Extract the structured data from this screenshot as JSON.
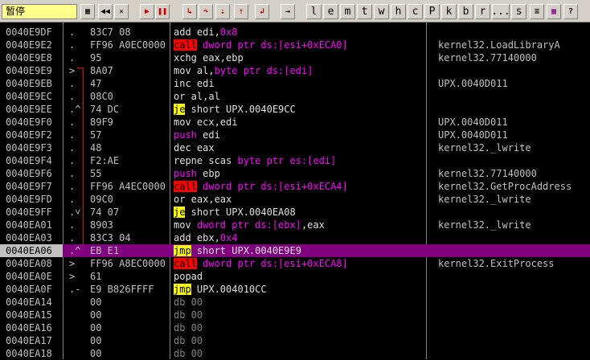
{
  "toolbar": {
    "status_text": "暂停",
    "buttons": [
      {
        "name": "open-file-icon",
        "glyph": "▦"
      },
      {
        "name": "rewind-icon",
        "glyph": "◀◀"
      },
      {
        "name": "close-icon",
        "glyph": "✕"
      },
      {
        "name": "run-icon",
        "glyph": "▶"
      },
      {
        "name": "pause-icon",
        "glyph": "❚❚"
      },
      {
        "name": "step-into-icon",
        "glyph": "↳"
      },
      {
        "name": "step-over-icon",
        "glyph": "↷"
      },
      {
        "name": "animate-into-icon",
        "glyph": "⇣"
      },
      {
        "name": "animate-over-icon",
        "glyph": "⇡"
      },
      {
        "name": "execute-till-return-icon",
        "glyph": "↲"
      },
      {
        "name": "goto-icon",
        "glyph": "→"
      }
    ],
    "letters": [
      "l",
      "e",
      "m",
      "t",
      "w",
      "h",
      "c",
      "P",
      "k",
      "b",
      "r",
      "...",
      "s"
    ],
    "right_icons": [
      {
        "name": "list-icon",
        "glyph": "≡"
      },
      {
        "name": "grid-icon",
        "glyph": "▦"
      },
      {
        "name": "help-icon",
        "glyph": "?"
      }
    ]
  },
  "rows": [
    {
      "addr": "0040E9DF",
      "jmp": ".",
      "hex": "83C7 08",
      "asm": [
        {
          "t": "add edi,"
        },
        {
          "t": "0x8",
          "c": "kw"
        }
      ],
      "cmt": ""
    },
    {
      "addr": "0040E9E2",
      "jmp": ".",
      "hex": "FF96 A0EC0000",
      "asm": [
        {
          "t": "call",
          "c": "mn-call"
        },
        {
          "t": " "
        },
        {
          "t": "dword ptr ds:[esi+0xECA0]",
          "c": "kw"
        }
      ],
      "cmt": "kernel32.LoadLibraryA"
    },
    {
      "addr": "0040E9E8",
      "jmp": ".",
      "hex": "95",
      "asm": [
        {
          "t": "xchg eax,ebp"
        }
      ],
      "cmt": "kernel32.77140000"
    },
    {
      "addr": "0040E9E9",
      "jmp": ">",
      "hex": "8A07",
      "asm": [
        {
          "t": "mov al,"
        },
        {
          "t": "byte ptr ds:[edi]",
          "c": "kw"
        }
      ],
      "cmt": ""
    },
    {
      "addr": "0040E9EB",
      "jmp": ".",
      "hex": "47",
      "asm": [
        {
          "t": "inc edi"
        }
      ],
      "cmt": "UPX.0040D011"
    },
    {
      "addr": "0040E9EC",
      "jmp": ".",
      "hex": "08C0",
      "asm": [
        {
          "t": "or al,al"
        }
      ],
      "cmt": ""
    },
    {
      "addr": "0040E9EE",
      "jmp": ".^",
      "hex": "74 DC",
      "asm": [
        {
          "t": "je",
          "c": "mn-jmp"
        },
        {
          "t": " short UPX.0040E9CC"
        }
      ],
      "cmt": ""
    },
    {
      "addr": "0040E9F0",
      "jmp": ".",
      "hex": "89F9",
      "asm": [
        {
          "t": "mov ecx,edi"
        }
      ],
      "cmt": "UPX.0040D011"
    },
    {
      "addr": "0040E9F2",
      "jmp": ".",
      "hex": "57",
      "asm": [
        {
          "t": "push",
          "c": "mn-push"
        },
        {
          "t": " edi"
        }
      ],
      "cmt": "UPX.0040D011"
    },
    {
      "addr": "0040E9F3",
      "jmp": ".",
      "hex": "48",
      "asm": [
        {
          "t": "dec eax"
        }
      ],
      "cmt": "kernel32._lwrite"
    },
    {
      "addr": "0040E9F4",
      "jmp": ".",
      "hex": "F2:AE",
      "asm": [
        {
          "t": "repne scas "
        },
        {
          "t": "byte ptr es:[edi]",
          "c": "kw"
        }
      ],
      "cmt": ""
    },
    {
      "addr": "0040E9F6",
      "jmp": ".",
      "hex": "55",
      "asm": [
        {
          "t": "push",
          "c": "mn-push"
        },
        {
          "t": " ebp"
        }
      ],
      "cmt": "kernel32.77140000"
    },
    {
      "addr": "0040E9F7",
      "jmp": ".",
      "hex": "FF96 A4EC0000",
      "asm": [
        {
          "t": "call",
          "c": "mn-call"
        },
        {
          "t": " "
        },
        {
          "t": "dword ptr ds:[esi+0xECA4]",
          "c": "kw"
        }
      ],
      "cmt": "kernel32.GetProcAddress"
    },
    {
      "addr": "0040E9FD",
      "jmp": ".",
      "hex": "09C0",
      "asm": [
        {
          "t": "or eax,eax"
        }
      ],
      "cmt": "kernel32._lwrite"
    },
    {
      "addr": "0040E9FF",
      "jmp": ".˅",
      "hex": "74 07",
      "asm": [
        {
          "t": "je",
          "c": "mn-jmp"
        },
        {
          "t": " short UPX.0040EA08"
        }
      ],
      "cmt": ""
    },
    {
      "addr": "0040EA01",
      "jmp": ".",
      "hex": "8903",
      "asm": [
        {
          "t": "mov "
        },
        {
          "t": "dword ptr ds:[ebx]",
          "c": "kw"
        },
        {
          "t": ",eax"
        }
      ],
      "cmt": "kernel32._lwrite"
    },
    {
      "addr": "0040EA03",
      "jmp": ".",
      "hex": "83C3 04",
      "asm": [
        {
          "t": "add ebx,"
        },
        {
          "t": "0x4",
          "c": "kw"
        }
      ],
      "cmt": ""
    },
    {
      "addr": "0040EA06",
      "jmp": ".^",
      "hex": "EB E1",
      "asm": [
        {
          "t": "jmp",
          "c": "mn-jmp"
        },
        {
          "t": " short UPX.0040E9E9"
        }
      ],
      "cmt": "",
      "hl": true
    },
    {
      "addr": "0040EA08",
      "jmp": ">",
      "hex": "FF96 A8EC0000",
      "asm": [
        {
          "t": "call",
          "c": "mn-call"
        },
        {
          "t": " "
        },
        {
          "t": "dword ptr ds:[esi+0xECA8]",
          "c": "kw"
        }
      ],
      "cmt": "kernel32.ExitProcess"
    },
    {
      "addr": "0040EA0E",
      "jmp": ">",
      "hex": "61",
      "asm": [
        {
          "t": "popad"
        }
      ],
      "cmt": ""
    },
    {
      "addr": "0040EA0F",
      "jmp": ".-",
      "hex": "E9 B826FFFF",
      "asm": [
        {
          "t": "jmp",
          "c": "mn-jmp"
        },
        {
          "t": " UPX.004010CC"
        }
      ],
      "cmt": ""
    },
    {
      "addr": "0040EA14",
      "jmp": "",
      "hex": "00",
      "asm": [
        {
          "t": "db 00",
          "c": "mn-db"
        }
      ],
      "cmt": ""
    },
    {
      "addr": "0040EA15",
      "jmp": "",
      "hex": "00",
      "asm": [
        {
          "t": "db 00",
          "c": "mn-db"
        }
      ],
      "cmt": ""
    },
    {
      "addr": "0040EA16",
      "jmp": "",
      "hex": "00",
      "asm": [
        {
          "t": "db 00",
          "c": "mn-db"
        }
      ],
      "cmt": ""
    },
    {
      "addr": "0040EA17",
      "jmp": "",
      "hex": "00",
      "asm": [
        {
          "t": "db 00",
          "c": "mn-db"
        }
      ],
      "cmt": ""
    },
    {
      "addr": "0040EA18",
      "jmp": "",
      "hex": "00",
      "asm": [
        {
          "t": "db 00",
          "c": "mn-db"
        }
      ],
      "cmt": ""
    }
  ]
}
